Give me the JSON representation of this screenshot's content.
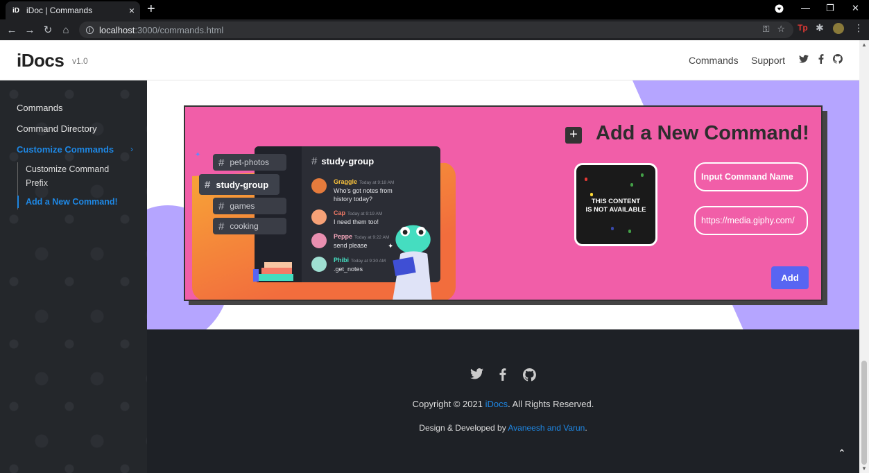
{
  "browser": {
    "tab_title": "iDoc | Commands",
    "tab_favicon": "iD",
    "url_host": "localhost",
    "url_path": ":3000/commands.html"
  },
  "header": {
    "brand": "iDocs",
    "version": "v1.0",
    "nav": [
      "Commands",
      "Support"
    ]
  },
  "sidebar": {
    "items": [
      "Commands",
      "Command Directory",
      "Customize Commands"
    ],
    "subitems": [
      "Customize Command",
      "Prefix",
      "Add a New Command!"
    ]
  },
  "card": {
    "title": "Add a New Command!",
    "gif_text_line1": "THIS CONTENT",
    "gif_text_line2": "IS NOT AVAILABLE",
    "name_placeholder": "Input Command Name",
    "url_value": "https://media.giphy.com/",
    "add_label": "Add"
  },
  "discord": {
    "channels": [
      "pet-photos",
      "study-group",
      "games",
      "cooking"
    ],
    "active_channel": "study-group",
    "messages": [
      {
        "name": "Graggle",
        "time": "Today at 9:18 AM",
        "text": "Who's got notes from history today?",
        "color": "#f9c23c"
      },
      {
        "name": "Cap",
        "time": "Today at 9:19 AM",
        "text": "I need them too!",
        "color": "#f47b67"
      },
      {
        "name": "Peppe",
        "time": "Today at 9:22 AM",
        "text": "send please",
        "color": "#f4a7bb"
      },
      {
        "name": "Phibi",
        "time": "Today at 9:30 AM",
        "text": ".get_notes",
        "color": "#45ddc0"
      }
    ]
  },
  "footer": {
    "copy_prefix": "Copyright © 2021 ",
    "copy_link": "iDocs",
    "copy_suffix": ". All Rights Reserved.",
    "design_prefix": "Design & Developed by ",
    "design_link": "Avaneesh and Varun",
    "design_suffix": "."
  }
}
